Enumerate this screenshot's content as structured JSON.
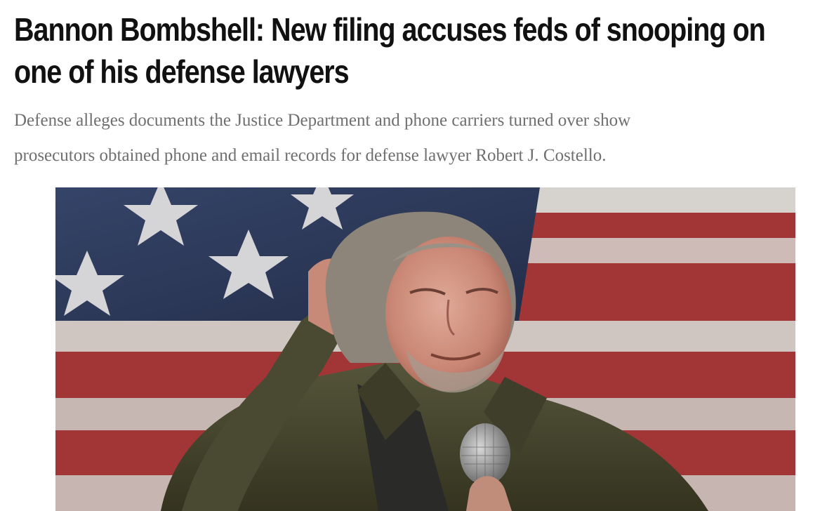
{
  "article": {
    "headline_lines": [
      "Bannon Bombshell: New filing accuses feds of snooping on",
      "one of his defense lawyers"
    ],
    "subhead_lines": [
      "Defense alleges documents the Justice Department and phone carriers turned over show",
      "prosecutors obtained phone and email records for defense lawyer Robert J. Costello."
    ]
  },
  "photo": {
    "subject": "man-with-microphone-photo",
    "background": "american-flag",
    "colors": {
      "flag_blue": "#2c3a5e",
      "flag_red": "#b03a3a",
      "flag_white": "#e9e4e0",
      "jacket": "#4a4a34",
      "skin": "#d8a08e",
      "hair": "#8d8378"
    }
  }
}
